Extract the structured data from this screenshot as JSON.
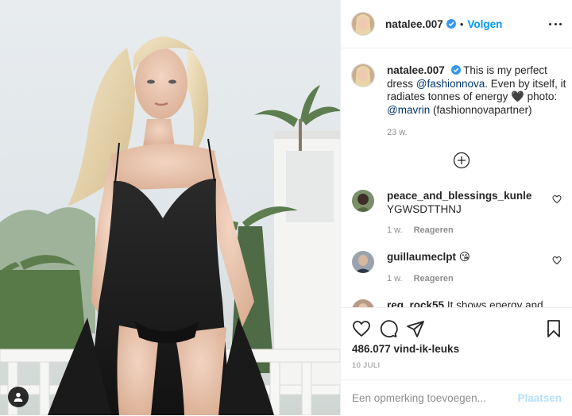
{
  "post": {
    "username": "natalee.007",
    "follow_label": "Volgen",
    "caption": {
      "username": "natalee.007",
      "text_1": "This is my perfect dress",
      "mention_1": "@fashionnova",
      "text_2": ". Even by itself, it radiates tonnes of energy 🖤 photo: ",
      "mention_2": "@mavrin",
      "text_3": "(fashionnovapartner)",
      "time": "23 w."
    },
    "comments": [
      {
        "username": "peace_and_blessings_kunle",
        "text": "YGWSDTTHNJ",
        "time": "1 w.",
        "reply_label": "Reageren"
      },
      {
        "username": "guillaumeclpt",
        "text": "😘",
        "time": "1 w.",
        "reply_label": "Reageren"
      },
      {
        "username": "reg_rock55",
        "text": "It shows energy and"
      }
    ],
    "likes": "486.077 vind-ik-leuks",
    "date": "10 JULI",
    "add_comment_placeholder": "Een opmerking toevoegen...",
    "post_button": "Plaatsen"
  },
  "colors": {
    "accent": "#0095f6",
    "post_button_disabled": "#b2dffc",
    "verified": "#3897f0",
    "secondary_text": "#8e8e8e"
  },
  "icons": [
    "verified-badge-icon",
    "more-options-icon",
    "load-more-icon",
    "heart-icon",
    "comment-icon",
    "share-icon",
    "bookmark-icon",
    "user-tag-icon"
  ]
}
